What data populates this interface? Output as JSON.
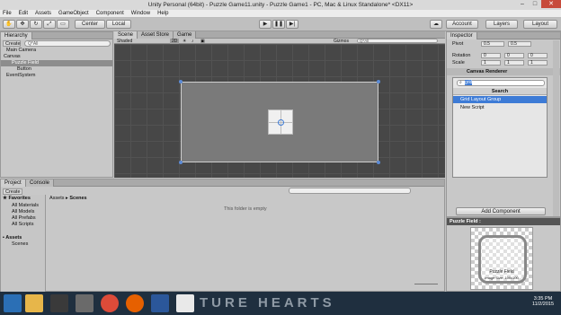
{
  "window": {
    "title": "Unity Personal (64bit) - Puzzle Game11.unity - Puzzle Game1 - PC, Mac & Linux Standalone* <DX11>"
  },
  "menu": [
    "File",
    "Edit",
    "Assets",
    "GameObject",
    "Component",
    "Window",
    "Help"
  ],
  "toolbar": {
    "center": "Center",
    "local": "Local",
    "account": "Account",
    "layers": "Layers",
    "layout": "Layout"
  },
  "hierarchy": {
    "tab": "Hierarchy",
    "create": "Create",
    "search": "Q*All",
    "items": [
      "Main Camera",
      "Canvas",
      "Puzzle Field",
      "Button",
      "EventSystem"
    ]
  },
  "scene": {
    "tabs": [
      "Scene",
      "Asset Store",
      "Game"
    ],
    "shaded": "Shaded",
    "mode": "2D",
    "gizmos": "Gizmos",
    "search": "Q*All"
  },
  "inspector": {
    "tab": "Inspector",
    "pivot_label": "Pivot",
    "pivot": {
      "x": "0.5",
      "y": "0.5"
    },
    "rotation_label": "Rotation",
    "rotation": {
      "x": "0",
      "y": "0",
      "z": "0"
    },
    "scale_label": "Scale",
    "scale": {
      "x": "1",
      "y": "1",
      "z": "1"
    },
    "component": "Canvas Renderer",
    "search_value": "grid",
    "search_header": "Search",
    "results": [
      "Grid Layout Group",
      "New Script"
    ],
    "add_component": "Add Component"
  },
  "project": {
    "tabs": [
      "Project",
      "Console"
    ],
    "create": "Create",
    "favorites": "Favorites",
    "fav_items": [
      "All Materials",
      "All Models",
      "All Prefabs",
      "All Scripts"
    ],
    "assets": "Assets",
    "asset_items": [
      "Scenes"
    ],
    "breadcrumb": [
      "Assets",
      "Scenes"
    ],
    "empty": "This folder is empty"
  },
  "preview": {
    "title": "Puzzle Field :",
    "label": "Puzzle Field",
    "info": "Image Size: 100x100"
  },
  "taskbar": {
    "banner": "TURE HEARTS",
    "time": "3:35 PM",
    "date": "11/2/2015"
  },
  "colors": {
    "selection": "#3d7bd6",
    "scene_bg": "#474747",
    "taskbar": "#1f2f3f"
  }
}
